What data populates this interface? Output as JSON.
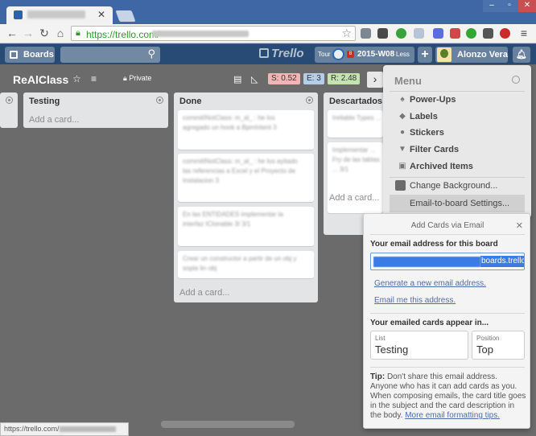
{
  "browser": {
    "url_host": "https://trello.com/",
    "status_text": "https://trello.com/"
  },
  "header": {
    "boards_label": "Boards",
    "logo_text": "Trello",
    "tour_label": "Tour",
    "notice_badge": "8",
    "sprint_label": "2015-W08",
    "less_label": "Less",
    "user_name": "Alonzo Vera"
  },
  "board": {
    "title": "ReAlClass",
    "visibility": "Private",
    "stat_s": "S: 0.52",
    "stat_e": "E: 3",
    "stat_r": "R: 2.48"
  },
  "lists": {
    "testing": {
      "name": "Testing",
      "add_card": "Add a card..."
    },
    "done": {
      "name": "Done",
      "add_card": "Add a card...",
      "cards": [
        "commitINotClass: m_al_ : he los agregado un hook a BpmIntent 3",
        "commitINotClass: m_al_ : he los ayitado las referencias a Excel y el Proyecto de Instalacion 3",
        "En las ENTIDADES implementar la interfaz IClonable 3/ 3/1",
        "Crear un constructor a partir de un obj y sopla lin obj"
      ]
    },
    "descartados": {
      "name": "Descartados",
      "add_card": "Add a card...",
      "cards": [
        "Ireliable Types ...",
        "Implementar ... Fry de las tablas ... 3/1"
      ]
    }
  },
  "menu": {
    "title": "Menu",
    "items": [
      {
        "icon": "power-ups-icon",
        "label": "Power-Ups"
      },
      {
        "icon": "labels-icon",
        "label": "Labels"
      },
      {
        "icon": "stickers-icon",
        "label": "Stickers"
      },
      {
        "icon": "filter-icon",
        "label": "Filter Cards"
      },
      {
        "icon": "archive-icon",
        "label": "Archived Items"
      }
    ],
    "change_background": "Change Background...",
    "email_settings": "Email-to-board Settings..."
  },
  "popup": {
    "title": "Add Cards via Email",
    "email_label": "Your email address for this board",
    "email_domain": "boards.trello",
    "generate_link": "Generate a new email address.",
    "email_me_link": "Email me this address.",
    "appear_label": "Your emailed cards appear in...",
    "list_caption": "List",
    "list_value": "Testing",
    "position_caption": "Position",
    "position_value": "Top",
    "tip_bold": "Tip:",
    "tip_text": "Don't share this email address. Anyone who has it can add cards as you. When composing emails, the card title goes in the subject and the card description in the body.",
    "tip_link": "More email formatting tips."
  },
  "colors": {
    "board_bg": "#6b6b6b",
    "header_bg": "#274b74",
    "chrome_blue": "#3f67a6",
    "stat_s": "#f0b6b6",
    "stat_e": "#b6cdea",
    "stat_r": "#c4e3b1"
  }
}
